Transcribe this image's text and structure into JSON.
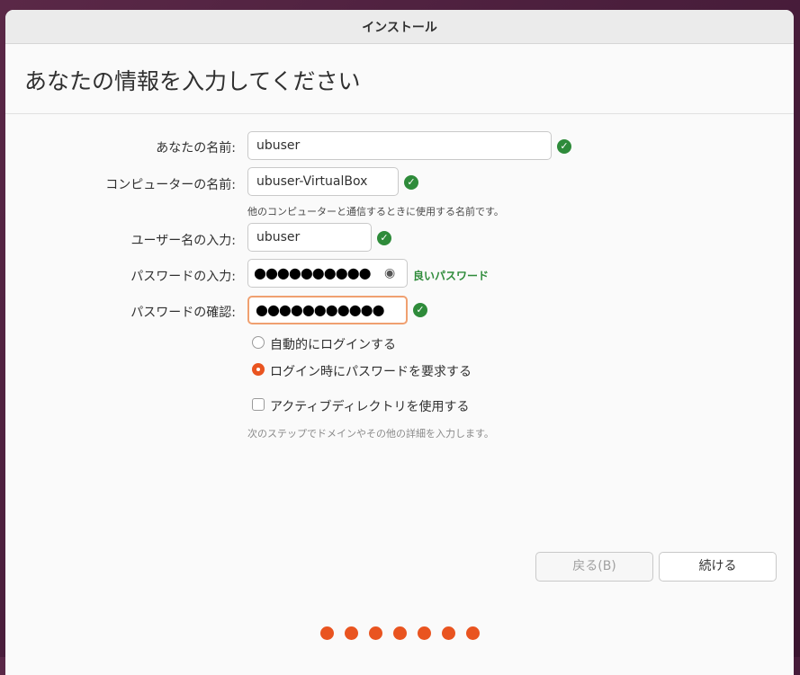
{
  "window": {
    "title": "インストール"
  },
  "page": {
    "heading": "あなたの情報を入力してください"
  },
  "form": {
    "name": {
      "label": "あなたの名前:",
      "value": "ubuser"
    },
    "computer": {
      "label": "コンピューターの名前:",
      "value": "ubuser-VirtualBox",
      "hint": "他のコンピューターと通信するときに使用する名前です。"
    },
    "username": {
      "label": "ユーザー名の入力:",
      "value": "ubuser"
    },
    "password": {
      "label": "パスワードの入力:",
      "value": "●●●●●●●●●●",
      "strength": "良いパスワード"
    },
    "confirm": {
      "label": "パスワードの確認:",
      "value": "●●●●●●●●●●●"
    }
  },
  "login": {
    "auto": "自動的にログインする",
    "require": "ログイン時にパスワードを要求する",
    "selected": "require"
  },
  "ad": {
    "label": "アクティブディレクトリを使用する",
    "checked": false,
    "hint": "次のステップでドメインやその他の詳細を入力します。"
  },
  "buttons": {
    "back": "戻る(B)",
    "continue": "続ける"
  },
  "progress": {
    "steps": 7
  },
  "colors": {
    "accent": "#e95420",
    "success": "#2e8b3a"
  }
}
